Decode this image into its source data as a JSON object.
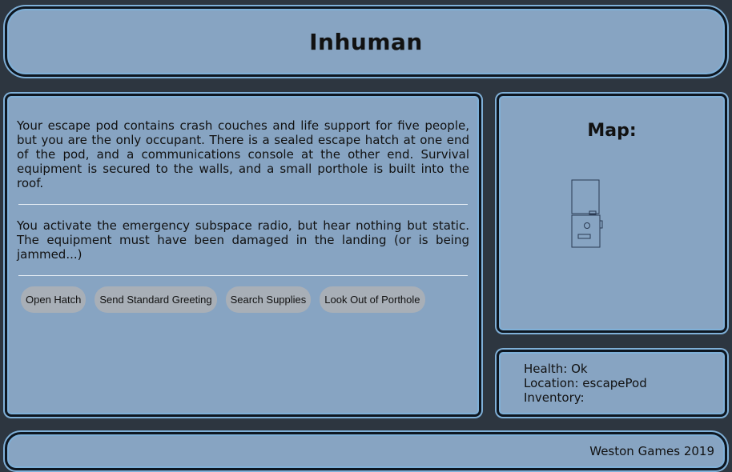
{
  "header": {
    "title": "Inhuman"
  },
  "story": {
    "paragraphs": [
      "Your escape pod contains crash couches and life support for five people, but you are the only occupant. There is a sealed escape hatch at one end of the pod, and a communications console at the other end. Survival equipment is secured to the walls, and a small porthole is built into the roof.",
      "You activate the emergency subspace radio, but hear nothing but static. The equipment must have been damaged in the landing (or is being jammed...)"
    ],
    "actions": [
      {
        "label": "Open Hatch"
      },
      {
        "label": "Send Standard Greeting"
      },
      {
        "label": "Search Supplies"
      },
      {
        "label": "Look Out of Porthole"
      }
    ]
  },
  "map": {
    "title": "Map:"
  },
  "status": {
    "health_label": "Health:",
    "health_value": "Ok",
    "location_label": "Location:",
    "location_value": "escapePod",
    "inventory_label": "Inventory:",
    "inventory_value": ""
  },
  "footer": {
    "credit": "Weston Games 2019"
  },
  "colors": {
    "background": "#2d3640",
    "panel": "#87a4c2",
    "panel_border": "#0d1620",
    "panel_glow": "#7fb0d8",
    "button": "#a8afb7"
  }
}
